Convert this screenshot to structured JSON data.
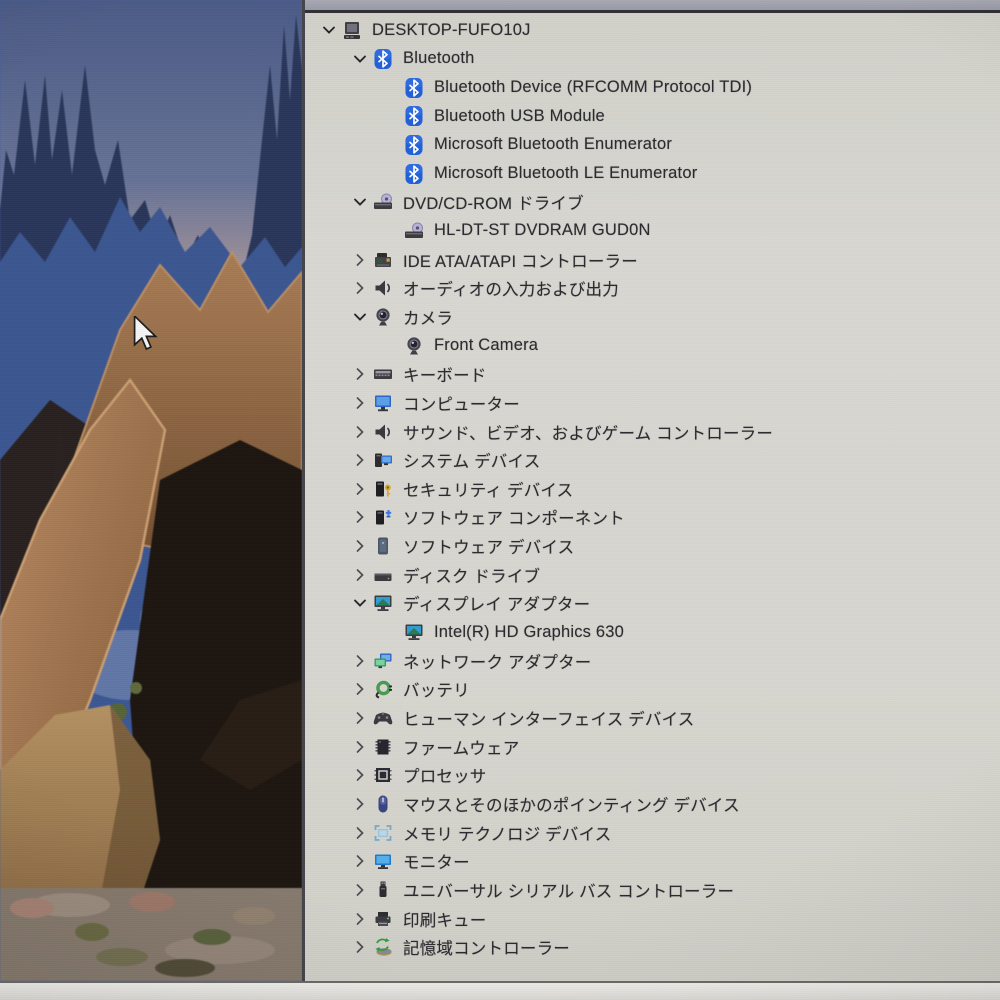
{
  "colors": {
    "window_bg": "#d6d5cf",
    "toolbar_strip": "#9b9da8",
    "text": "#2b2b2f",
    "bluetooth_blue": "#2260d8",
    "monitor_blue": "#2e6fc8",
    "key_gold": "#d8a832",
    "battery_green": "#4a9a50"
  },
  "cursor": {
    "type": "arrow"
  },
  "tree": {
    "items": [
      {
        "label": "DESKTOP-FUFO10J",
        "level": 0,
        "state": "expanded",
        "icon": "computer-icon"
      },
      {
        "label": "Bluetooth",
        "level": 1,
        "state": "expanded",
        "icon": "bluetooth-icon"
      },
      {
        "label": "Bluetooth Device (RFCOMM Protocol TDI)",
        "level": 2,
        "state": "none",
        "icon": "bluetooth-icon"
      },
      {
        "label": "Bluetooth USB Module",
        "level": 2,
        "state": "none",
        "icon": "bluetooth-icon"
      },
      {
        "label": "Microsoft Bluetooth Enumerator",
        "level": 2,
        "state": "none",
        "icon": "bluetooth-icon"
      },
      {
        "label": "Microsoft Bluetooth LE Enumerator",
        "level": 2,
        "state": "none",
        "icon": "bluetooth-icon"
      },
      {
        "label": "DVD/CD-ROM ドライブ",
        "level": 1,
        "state": "expanded",
        "icon": "dvd-drive-icon"
      },
      {
        "label": "HL-DT-ST DVDRAM GUD0N",
        "level": 2,
        "state": "none",
        "icon": "dvd-drive-icon"
      },
      {
        "label": "IDE ATA/ATAPI コントローラー",
        "level": 1,
        "state": "collapsed",
        "icon": "ide-controller-icon"
      },
      {
        "label": "オーディオの入力および出力",
        "level": 1,
        "state": "collapsed",
        "icon": "speaker-icon"
      },
      {
        "label": "カメラ",
        "level": 1,
        "state": "expanded",
        "icon": "camera-icon"
      },
      {
        "label": "Front Camera",
        "level": 2,
        "state": "none",
        "icon": "camera-icon"
      },
      {
        "label": "キーボード",
        "level": 1,
        "state": "collapsed",
        "icon": "keyboard-icon"
      },
      {
        "label": "コンピューター",
        "level": 1,
        "state": "collapsed",
        "icon": "computer-monitor-icon"
      },
      {
        "label": "サウンド、ビデオ、およびゲーム コントローラー",
        "level": 1,
        "state": "collapsed",
        "icon": "speaker-icon"
      },
      {
        "label": "システム デバイス",
        "level": 1,
        "state": "collapsed",
        "icon": "system-devices-icon"
      },
      {
        "label": "セキュリティ デバイス",
        "level": 1,
        "state": "collapsed",
        "icon": "security-device-icon"
      },
      {
        "label": "ソフトウェア コンポーネント",
        "level": 1,
        "state": "collapsed",
        "icon": "software-component-icon"
      },
      {
        "label": "ソフトウェア デバイス",
        "level": 1,
        "state": "collapsed",
        "icon": "software-device-icon"
      },
      {
        "label": "ディスク ドライブ",
        "level": 1,
        "state": "collapsed",
        "icon": "disk-drive-icon"
      },
      {
        "label": "ディスプレイ アダプター",
        "level": 1,
        "state": "expanded",
        "icon": "display-adapter-icon"
      },
      {
        "label": "Intel(R) HD Graphics 630",
        "level": 2,
        "state": "none",
        "icon": "display-adapter-icon"
      },
      {
        "label": "ネットワーク アダプター",
        "level": 1,
        "state": "collapsed",
        "icon": "network-adapter-icon"
      },
      {
        "label": "バッテリ",
        "level": 1,
        "state": "collapsed",
        "icon": "battery-icon"
      },
      {
        "label": "ヒューマン インターフェイス デバイス",
        "level": 1,
        "state": "collapsed",
        "icon": "hid-gamepad-icon"
      },
      {
        "label": "ファームウェア",
        "level": 1,
        "state": "collapsed",
        "icon": "firmware-chip-icon"
      },
      {
        "label": "プロセッサ",
        "level": 1,
        "state": "collapsed",
        "icon": "processor-icon"
      },
      {
        "label": "マウスとそのほかのポインティング デバイス",
        "level": 1,
        "state": "collapsed",
        "icon": "mouse-icon"
      },
      {
        "label": "メモリ テクノロジ デバイス",
        "level": 1,
        "state": "collapsed",
        "icon": "memory-chip-icon"
      },
      {
        "label": "モニター",
        "level": 1,
        "state": "collapsed",
        "icon": "monitor-icon"
      },
      {
        "label": "ユニバーサル シリアル バス コントローラー",
        "level": 1,
        "state": "collapsed",
        "icon": "usb-icon"
      },
      {
        "label": "印刷キュー",
        "level": 1,
        "state": "collapsed",
        "icon": "printer-icon"
      },
      {
        "label": "記憶域コントローラー",
        "level": 1,
        "state": "collapsed",
        "icon": "storage-controller-icon"
      }
    ]
  }
}
